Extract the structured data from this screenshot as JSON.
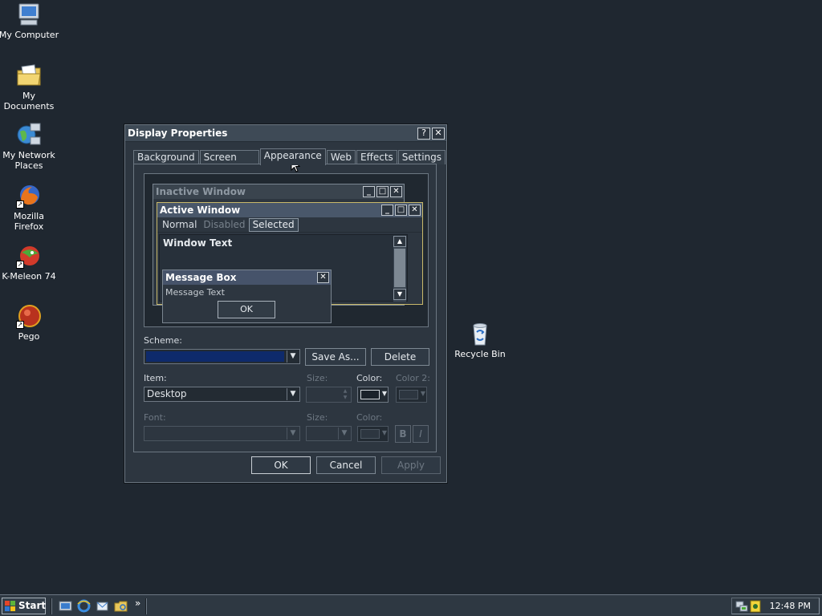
{
  "desktop": {
    "icons": [
      {
        "label": "My Computer",
        "icon": "computer-icon"
      },
      {
        "label": "My Documents",
        "icon": "folder-documents-icon"
      },
      {
        "label": "My Network Places",
        "icon": "network-icon"
      },
      {
        "label": "Mozilla Firefox",
        "icon": "firefox-icon"
      },
      {
        "label": "K-Meleon 74",
        "icon": "kmeleon-icon"
      },
      {
        "label": "Pego",
        "icon": "pego-icon"
      },
      {
        "label": "Recycle Bin",
        "icon": "recycle-bin-icon"
      }
    ]
  },
  "dialog": {
    "title": "Display Properties",
    "help_btn": "?",
    "close_btn": "✕",
    "tabs": [
      "Background",
      "Screen Saver",
      "Appearance",
      "Web",
      "Effects",
      "Settings"
    ],
    "active_tab": "Appearance",
    "preview": {
      "inactive_title": "Inactive Window",
      "active_title": "Active Window",
      "menu": {
        "normal": "Normal",
        "disabled": "Disabled",
        "selected": "Selected"
      },
      "window_text": "Window Text",
      "msgbox_title": "Message Box",
      "msgbox_text": "Message Text",
      "msgbox_ok": "OK"
    },
    "scheme_label": "Scheme:",
    "scheme_value": "",
    "save_as_btn": "Save As...",
    "delete_btn": "Delete",
    "item_label": "Item:",
    "item_value": "Desktop",
    "size_label": "Size:",
    "color_label": "Color:",
    "color2_label": "Color 2:",
    "font_label": "Font:",
    "font_size_label": "Size:",
    "font_color_label": "Color:",
    "bold_btn": "B",
    "italic_btn": "I",
    "ok_btn": "OK",
    "cancel_btn": "Cancel",
    "apply_btn": "Apply"
  },
  "taskbar": {
    "start_label": "Start",
    "chevron": "»",
    "clock": "12:48 PM"
  },
  "colors": {
    "desktop_bg": "#1f2730",
    "dialog_bg": "#2d3640",
    "scheme_fill": "#0e2a6b",
    "active_border": "#c9b96a"
  }
}
